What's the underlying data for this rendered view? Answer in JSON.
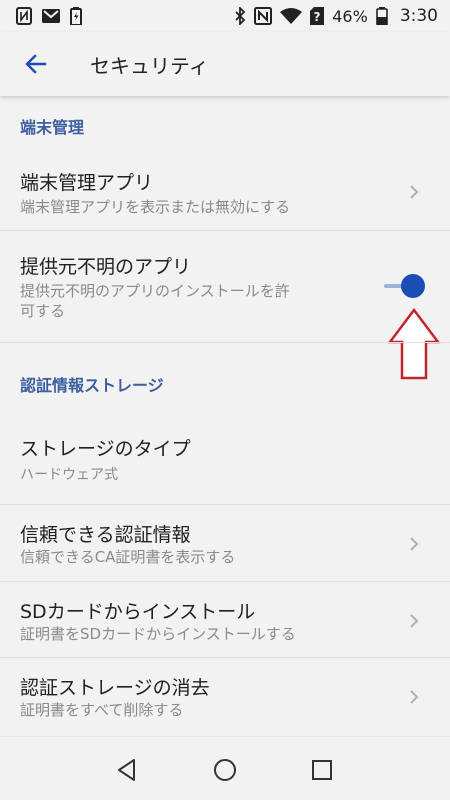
{
  "status_bar": {
    "battery_percent": "46%",
    "time": "3:30",
    "left_icons": [
      "nfc-tag-icon",
      "mail-icon",
      "battery-small-icon"
    ],
    "right_icons": [
      "bluetooth-icon",
      "nfc-icon",
      "wifi-icon",
      "sim-alert-icon",
      "battery-icon"
    ]
  },
  "app_bar": {
    "title": "セキュリティ",
    "back_icon": "arrow-left-icon"
  },
  "sections": {
    "device_admin": {
      "header": "端末管理",
      "item_title": "端末管理アプリ",
      "item_sub": "端末管理アプリを表示または無効にする"
    },
    "unknown_sources": {
      "title": "提供元不明のアプリ",
      "sub_line1": "提供元不明のアプリのインストールを許",
      "sub_line2": "可する",
      "enabled": true
    },
    "credential_storage": {
      "header": "認証情報ストレージ",
      "storage_type_title": "ストレージのタイプ",
      "storage_type_value": "ハードウェア式",
      "trusted_title": "信頼できる認証情報",
      "trusted_sub": "信頼できるCA証明書を表示する",
      "install_sd_title": "SDカードからインストール",
      "install_sd_sub": "証明書をSDカードからインストールする",
      "clear_title": "認証ストレージの消去",
      "clear_sub": "証明書をすべて削除する"
    }
  },
  "annotation": {
    "icon": "red-up-arrow-icon",
    "color": "#c0262c"
  },
  "colors": {
    "accent": "#1c4db5",
    "section_header": "#3d5fa0",
    "background": "#f2f2f2"
  },
  "nav_bar": {
    "icons": [
      "back-triangle-icon",
      "home-circle-icon",
      "recents-square-icon"
    ]
  }
}
